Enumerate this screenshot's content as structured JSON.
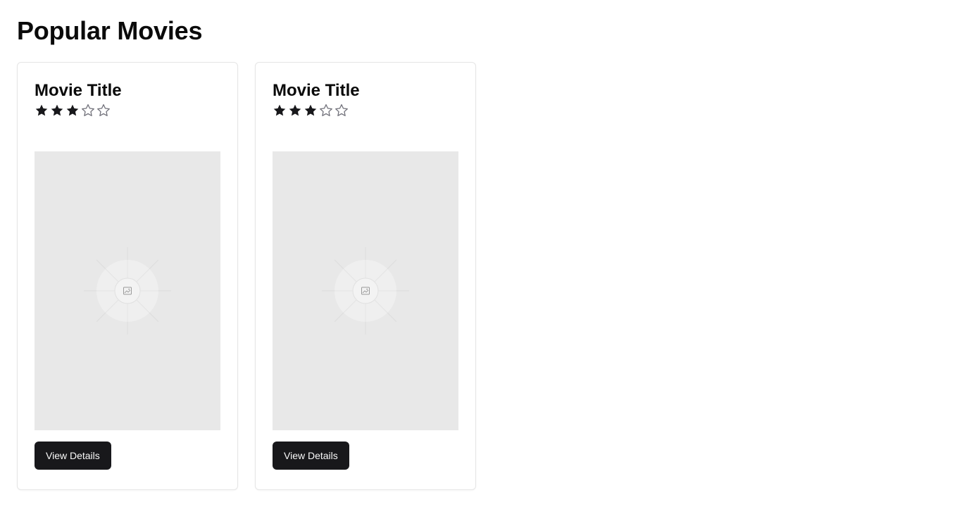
{
  "page": {
    "title": "Popular Movies"
  },
  "movies": [
    {
      "title": "Movie Title",
      "rating": 3,
      "rating_max": 5,
      "poster_icon": "image-placeholder-icon",
      "button_label": "View Details"
    },
    {
      "title": "Movie Title",
      "rating": 3,
      "rating_max": 5,
      "poster_icon": "image-placeholder-icon",
      "button_label": "View Details"
    }
  ],
  "colors": {
    "star_filled": "#18181b",
    "star_empty": "#71717a",
    "button_bg": "#18181b",
    "button_text": "#fafafa",
    "poster_bg": "#e8e8e8",
    "card_border": "#e5e5e5"
  }
}
